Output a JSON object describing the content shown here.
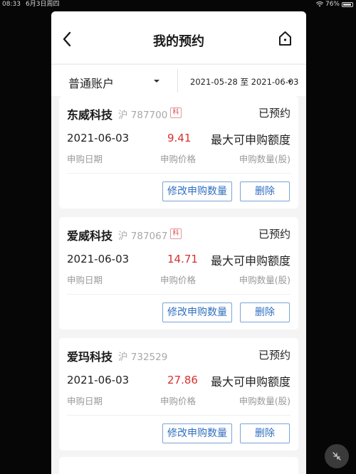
{
  "status_bar": {
    "time": "08:33",
    "date": "6月3日周四",
    "battery": "76%",
    "icons": [
      "wifi-icon",
      "battery-icon"
    ]
  },
  "header": {
    "title": "我的预约",
    "back_icon": "chevron-left-icon",
    "home_icon": "home-icon"
  },
  "filters": {
    "account": "普通账户",
    "date_range": "2021-05-28 至 2021-06-03"
  },
  "cards": [
    {
      "name": "东威科技",
      "code": "沪 787700",
      "badge": "科",
      "status": "已预约",
      "apply_date": "2021-06-03",
      "price": "9.41",
      "quantity": "最大可申购额度",
      "labels": {
        "date": "申购日期",
        "price": "申购价格",
        "quantity": "申购数量(股)"
      },
      "actions": {
        "modify": "修改申购数量",
        "delete": "删除"
      }
    },
    {
      "name": "爱威科技",
      "code": "沪 787067",
      "badge": "科",
      "status": "已预约",
      "apply_date": "2021-06-03",
      "price": "14.71",
      "quantity": "最大可申购额度",
      "labels": {
        "date": "申购日期",
        "price": "申购价格",
        "quantity": "申购数量(股)"
      },
      "actions": {
        "modify": "修改申购数量",
        "delete": "删除"
      }
    },
    {
      "name": "爱玛科技",
      "code": "沪 732529",
      "badge": "",
      "status": "已预约",
      "apply_date": "2021-06-03",
      "price": "27.86",
      "quantity": "最大可申购额度",
      "labels": {
        "date": "申购日期",
        "price": "申购价格",
        "quantity": "申购数量(股)"
      },
      "actions": {
        "modify": "修改申购数量",
        "delete": "删除"
      }
    }
  ],
  "colors": {
    "price_red": "#d6312e",
    "button_blue": "#2f6fbf",
    "background": "#f4f4f4"
  },
  "floating_button_icon": "collapse-arrows-icon"
}
